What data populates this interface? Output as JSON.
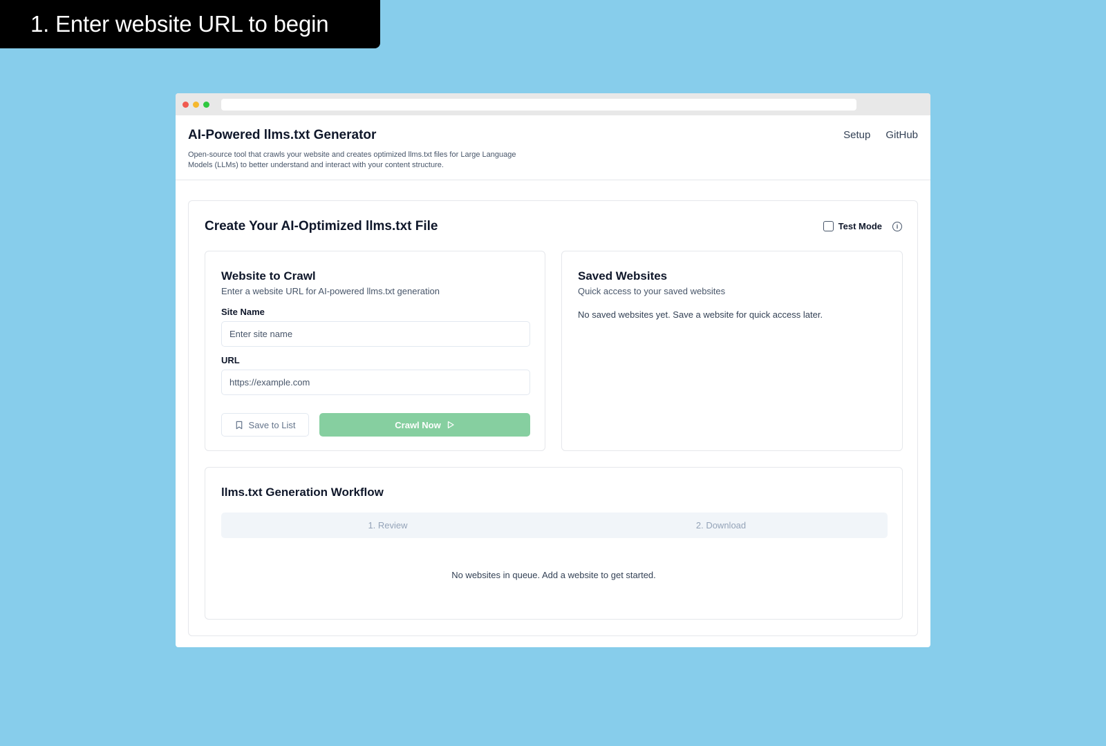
{
  "banner": {
    "text": "1.  Enter website URL to begin"
  },
  "app": {
    "title": "AI-Powered llms.txt Generator",
    "description": "Open-source tool that crawls your website and creates optimized llms.txt files for Large Language Models (LLMs) to better understand and interact with your content structure.",
    "nav": {
      "setup": "Setup",
      "github": "GitHub"
    }
  },
  "main": {
    "title": "Create Your AI-Optimized llms.txt File",
    "test_mode_label": "Test Mode",
    "crawl": {
      "title": "Website to Crawl",
      "subtitle": "Enter a website URL for AI-powered llms.txt generation",
      "site_name_label": "Site Name",
      "site_name_placeholder": "Enter site name",
      "url_label": "URL",
      "url_placeholder": "https://example.com",
      "save_label": "Save to List",
      "crawl_label": "Crawl Now"
    },
    "saved": {
      "title": "Saved Websites",
      "subtitle": "Quick access to your saved websites",
      "empty": "No saved websites yet. Save a website for quick access later."
    },
    "workflow": {
      "title": "llms.txt Generation Workflow",
      "tabs": [
        {
          "label": "1. Review"
        },
        {
          "label": "2. Download"
        }
      ],
      "empty": "No websites in queue. Add a website to get started."
    }
  },
  "colors": {
    "background": "#87cdeb",
    "accent_green": "#86cfa0",
    "banner": "#000000"
  }
}
